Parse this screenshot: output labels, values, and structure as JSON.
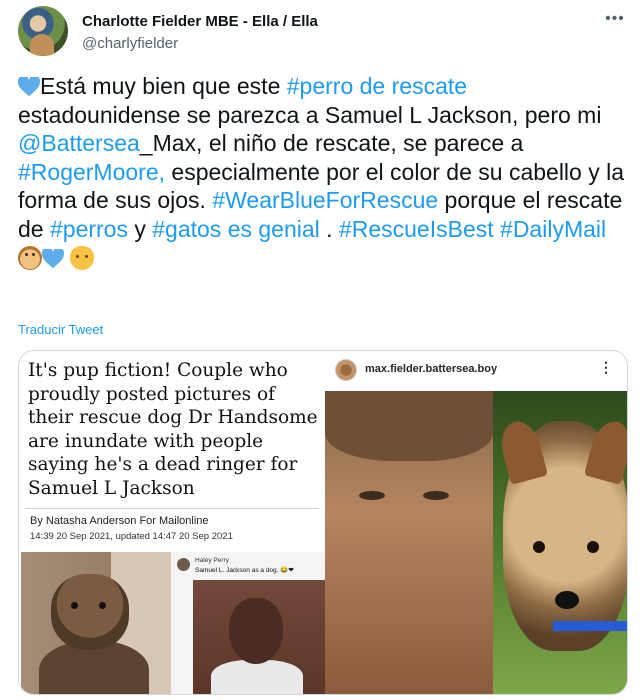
{
  "user": {
    "display_name": "Charlotte Fielder MBE - Ella / Ella",
    "handle": "@charlyfielder"
  },
  "tweet": {
    "segments": [
      {
        "type": "emoji",
        "name": "blue-heart-icon"
      },
      {
        "type": "text",
        "value": "Está muy bien que este "
      },
      {
        "type": "tag",
        "value": "#perro de rescate"
      },
      {
        "type": "text",
        "value": " estadounidense se parezca a Samuel L Jackson, pero mi "
      },
      {
        "type": "tag",
        "value": "@Battersea"
      },
      {
        "type": "text",
        "value": "_Max, el niño de rescate, se parece a "
      },
      {
        "type": "tag",
        "value": "#RogerMoore,"
      },
      {
        "type": "text",
        "value": " especialmente por el color de su cabello y la forma de sus ojos. "
      },
      {
        "type": "tag",
        "value": "#WearBlueForRescue"
      },
      {
        "type": "text",
        "value": " porque el rescate de "
      },
      {
        "type": "tag",
        "value": "#perros"
      },
      {
        "type": "text",
        "value": " y "
      },
      {
        "type": "tag",
        "value": "#gatos es genial"
      },
      {
        "type": "text",
        "value": " . "
      },
      {
        "type": "tag",
        "value": "#RescueIsBest"
      },
      {
        "type": "text",
        "value": " "
      },
      {
        "type": "tag",
        "value": "#DailyMail"
      },
      {
        "type": "emoji",
        "name": "dog-face-icon"
      },
      {
        "type": "emoji",
        "name": "blue-heart-icon"
      },
      {
        "type": "text",
        "value": " "
      },
      {
        "type": "emoji",
        "name": "cat-face-icon"
      }
    ],
    "translate_label": "Traducir Tweet",
    "link_color": "#1d9bf0"
  },
  "media": {
    "article": {
      "headline": "It's pup fiction! Couple who proudly posted pictures of their rescue dog Dr Handsome are inundate with people saying he's a dead ringer for Samuel L Jackson",
      "byline": "By Natasha Anderson For Mailonline",
      "date": "14:39 20 Sep 2021, updated 14:47 20 Sep 2021",
      "comment_name": "Haley Perry",
      "comment_text": "Samuel L. Jackson as a dog. 😂❤"
    },
    "instagram": {
      "username": "max.fielder.battersea.boy",
      "more_icon": "vertical-dots-icon"
    }
  }
}
